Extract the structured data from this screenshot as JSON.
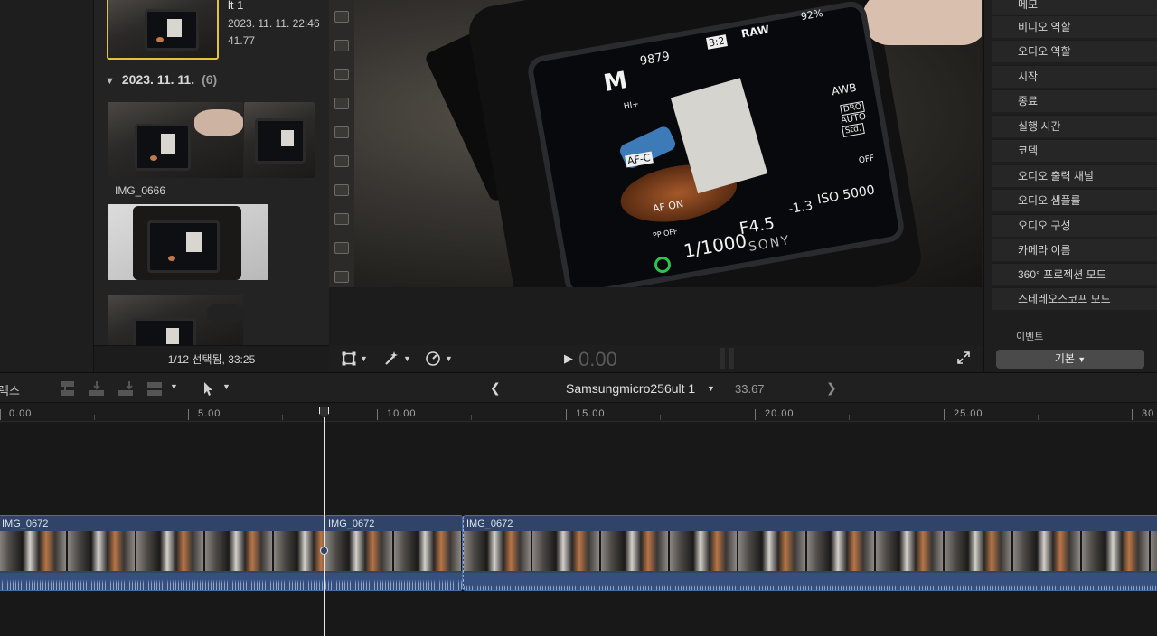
{
  "browser": {
    "selected_clip": {
      "title": "lt 1",
      "date": "2023. 11. 11. 22:46",
      "duration": "41.77"
    },
    "group": {
      "date": "2023. 11. 11.",
      "count": "(6)"
    },
    "clips": [
      {
        "name": "IMG_0666"
      }
    ],
    "status": "1/12 선택됨, 33:25"
  },
  "viewer": {
    "timecode": "0.00",
    "osd": {
      "shots": "9879",
      "mode": "M",
      "aspect": "3:2",
      "raw": "RAW",
      "battery": "92%",
      "awb": "AWB",
      "dro": "DRO",
      "dro_auto": "AUTO",
      "std": "Std.",
      "af": "AF-C",
      "af_on": "AF ON",
      "shutter": "1/1000",
      "aperture": "F4.5",
      "ev": "-1.3",
      "iso": "ISO 5000",
      "brand": "SONY",
      "hi": "HI+",
      "off": "OFF",
      "pp": "PP OFF"
    }
  },
  "inspector": {
    "items": [
      "메모",
      "비디오 역할",
      "오디오 역할",
      "시작",
      "종료",
      "실행 시간",
      "코덱",
      "오디오 출력 채널",
      "오디오 샘플률",
      "오디오 구성",
      "카메라 이름",
      "360° 프로젝션 모드",
      "스테레오스코프 모드"
    ],
    "section_label": "이벤트",
    "preset": "기본"
  },
  "timeline": {
    "index_label": "렉스",
    "project_name": "Samsungmicro256ult 1",
    "project_duration": "33.67",
    "ruler": [
      "0.00",
      "5.00",
      "10.00",
      "15.00",
      "20.00",
      "25.00",
      "30"
    ],
    "clips": [
      {
        "name": "IMG_0672"
      },
      {
        "name": "IMG_0672"
      },
      {
        "name": "IMG_0672"
      }
    ]
  },
  "colors": {
    "selection": "#e2c33b",
    "clip_fill": "#2f4466",
    "clip_border": "#4b6ea8"
  }
}
